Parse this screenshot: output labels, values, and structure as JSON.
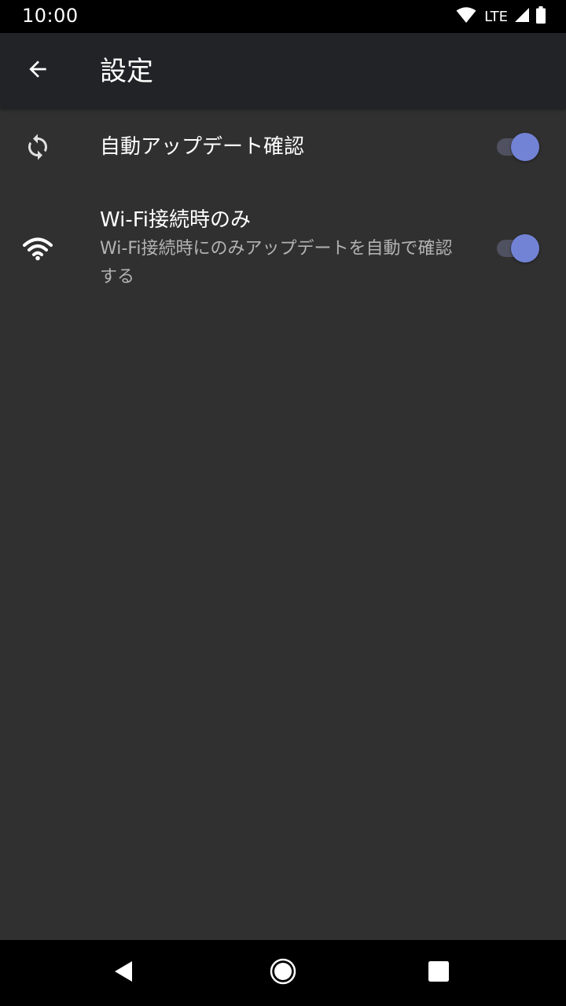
{
  "status_bar": {
    "time": "10:00",
    "network_label": "LTE",
    "icons": [
      "wifi-icon",
      "cell-signal-icon",
      "battery-icon"
    ]
  },
  "app_bar": {
    "title": "設定",
    "back_icon": "arrow-back-icon"
  },
  "preferences": [
    {
      "title": "自動アップデート確認",
      "summary": "",
      "icon": "sync-icon",
      "checked": true
    },
    {
      "title": "Wi-Fi接続時のみ",
      "summary": "Wi-Fi接続時にのみアップデートを自動で確認する",
      "icon": "wifi-icon",
      "checked": true
    }
  ],
  "colors": {
    "background": "#303030",
    "app_bar": "#212326",
    "accent": "#7283d6",
    "track": "#4f5160"
  },
  "nav_bar": {
    "buttons": [
      "back-triangle-icon",
      "home-circle-icon",
      "recents-square-icon"
    ]
  }
}
